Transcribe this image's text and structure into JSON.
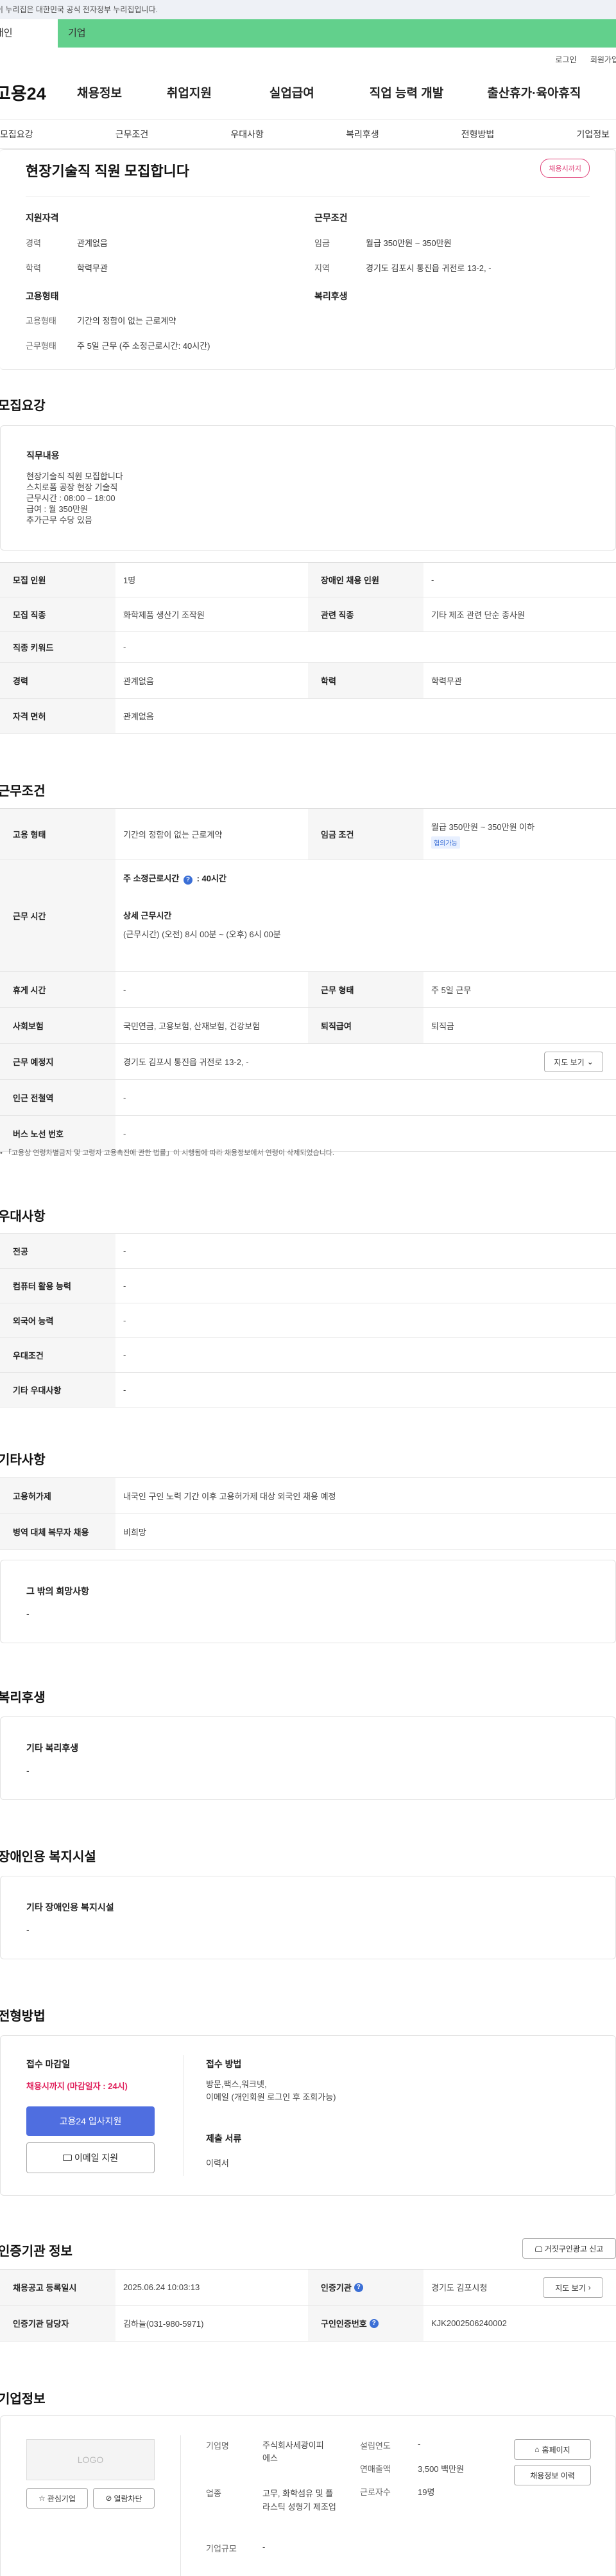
{
  "banner": {
    "text": "이 누리집은 대한민국 공식 전자정부 누리집입니다."
  },
  "user_tabs": {
    "individual": "개인",
    "company": "기업"
  },
  "util": {
    "login": "로그인",
    "join": "회원가입"
  },
  "gnb": {
    "logo": "고용24",
    "items": [
      "채용정보",
      "취업지원",
      "실업급여",
      "직업 능력 개발",
      "출산휴가·육아휴직"
    ]
  },
  "subnav": [
    "모집요강",
    "근무조건",
    "우대사항",
    "복리후생",
    "전형방법",
    "기업정보"
  ],
  "summary": {
    "title": "현장기술직 직원 모집합니다",
    "badge": "채용시까지",
    "qual_title": "지원자격",
    "career_label": "경력",
    "career_value": "관계없음",
    "edu_label": "학력",
    "edu_value": "학력무관",
    "cond_title": "근무조건",
    "wage_label": "임금",
    "wage_value": "월급 350만원 ~ 350만원",
    "region_label": "지역",
    "region_value": "경기도 김포시 통진읍 귀전로 13-2, -",
    "emp_title": "고용형태",
    "type_label": "고용형태",
    "type_value": "기간의 정함이 없는 근로계약",
    "hours_label": "근무형태",
    "hours_value": "주 5일 근무 (주 소정근로시간: 40시간)",
    "welfare_title": "복리후생"
  },
  "recruit": {
    "title": "모집요강",
    "duty_title": "직무내용",
    "duty_lines": [
      "현장기술직 직원 모집합니다",
      "스치로폼 공장 현장 기술직",
      "근무시간 : 08:00 ~ 18:00",
      "급여 : 월 350만원",
      "추가근무 수당 있음"
    ],
    "rows": [
      [
        "모집 인원",
        "1명",
        "장애인 채용 인원",
        "-"
      ],
      [
        "모집 직종",
        "화학제품 생산기 조작원",
        "관련 직종",
        "기타 제조 관련 단순 종사원"
      ],
      [
        "직종 키워드",
        "-"
      ],
      [
        "경력",
        "관계없음",
        "학력",
        "학력무관"
      ],
      [
        "자격 면허",
        "관계없음"
      ]
    ]
  },
  "work": {
    "title": "근무조건",
    "emp_type_label": "고용 형태",
    "emp_type_value": "기간의 정함이 없는 근로계약",
    "wage_label": "임금 조건",
    "wage_value": "월급 350만원 ~ 350만원 이하",
    "wage_badge": "협의가능",
    "time_label": "근무 시간",
    "weekly_label": "주 소정근로시간",
    "weekly_value": ": 40시간",
    "detail_label": "상세 근무시간",
    "detail_value": "(근무시간) (오전) 8시 00분 ~ (오후) 6시 00분",
    "rows": [
      [
        "휴게 시간",
        "-",
        "근무 형태",
        "주 5일 근무"
      ],
      [
        "사회보험",
        "국민연금, 고용보험, 산재보험, 건강보험",
        "퇴직급여",
        "퇴직금"
      ]
    ],
    "place_label": "근무 예정지",
    "place_value": "경기도 김포시 통진읍 귀전로 13-2, -",
    "map_btn": "지도 보기",
    "subway_label": "인근 전철역",
    "subway_value": "-",
    "bus_label": "버스 노선 번호",
    "bus_value": "-",
    "note": "「고용상 연령차별금지 및 고령자 고용촉진에 관한 법률」이 시행됨에 따라 채용정보에서 연령이 삭제되었습니다."
  },
  "prefer": {
    "title": "우대사항",
    "rows": [
      [
        "전공",
        "-"
      ],
      [
        "컴퓨터 활용 능력",
        "-"
      ],
      [
        "외국어 능력",
        "-"
      ],
      [
        "우대조건",
        "-"
      ],
      [
        "기타 우대사항",
        "-"
      ]
    ]
  },
  "etc": {
    "title": "기타사항",
    "rows": [
      [
        "고용허가제",
        "내국인 구인 노력 기간 이후 고용허가제 대상 외국인 채용 예정"
      ],
      [
        "병역 대체 복무자 채용",
        "비희망"
      ]
    ],
    "box_title": "그 밖의 희망사항",
    "box_value": "-"
  },
  "welfare": {
    "title": "복리후생",
    "box_title": "기타 복리후생",
    "box_value": "-"
  },
  "disabled": {
    "title": "장애인용 복지시설",
    "box_title": "기타 장애인용 복지시설",
    "box_value": "-"
  },
  "screening": {
    "title": "전형방법",
    "deadline_label": "접수 마감일",
    "deadline_value": "채용시까지 (마감일자 : 24시)",
    "apply_btn": "고용24 입사지원",
    "email_btn": "이메일 지원",
    "method_label": "접수 방법",
    "method_value": "방문,팩스,워크넷,",
    "method_value2": "이메일 (개인회원 로그인 후 조회가능)",
    "docs_label": "제출 서류",
    "docs_value": "이력서"
  },
  "cert": {
    "title": "인증기관 정보",
    "report_btn": "거짓구인광고 신고",
    "rows": [
      [
        "채용공고 등록일시",
        "2025.06.24 10:03:13",
        "인증기관",
        "경기도 김포시청"
      ],
      [
        "인증기관 담당자",
        "김하늘(031-980-5971)",
        "구인인증번호",
        "KJK2002506240002"
      ]
    ],
    "map_btn": "지도 보기"
  },
  "company": {
    "title": "기업정보",
    "logo": "LOGO",
    "fav_btn": "관심기업",
    "block_btn": "열람차단",
    "name_label": "기업명",
    "name_value": "주식회사세광이피에스",
    "biz_label": "업종",
    "biz_value": "고무, 화학섬유 및 플라스틱 성형기 제조업",
    "size_label": "기업규모",
    "size_value": "-",
    "year_label": "설립연도",
    "year_value": "-",
    "sales_label": "연매출액",
    "sales_value": "3,500 백만원",
    "emp_label": "근로자수",
    "emp_value": "19명",
    "home_btn": "홈페이지",
    "more_btn": "채용정보 이력"
  }
}
